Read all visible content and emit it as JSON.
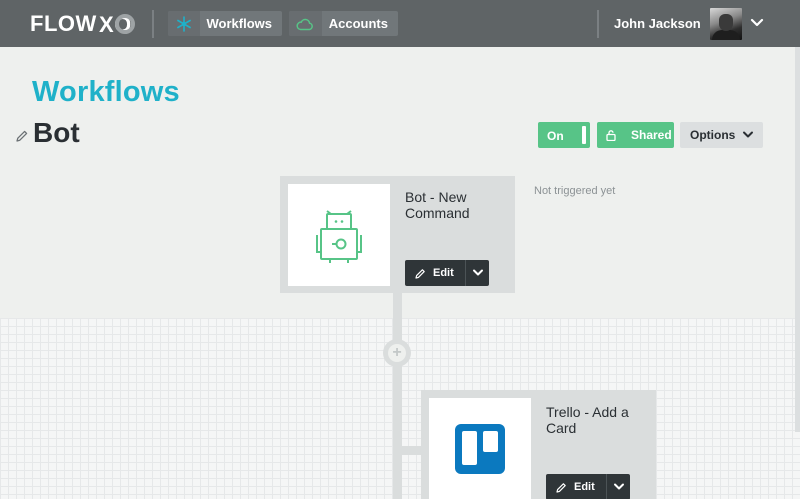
{
  "app": {
    "brand_left": "FLOW",
    "brand_right": "XO"
  },
  "nav": {
    "items": [
      {
        "label": "Workflows",
        "icon": "snowflake-icon"
      },
      {
        "label": "Accounts",
        "icon": "cloud-icon"
      }
    ]
  },
  "user": {
    "name": "John Jackson"
  },
  "page": {
    "title": "Workflows",
    "workflow_name": "Bot"
  },
  "controls": {
    "toggle_label": "On",
    "shared_label": "Shared",
    "options_label": "Options"
  },
  "steps": [
    {
      "title": "Bot - New Command",
      "edit_label": "Edit",
      "status": "Not triggered yet",
      "icon": "robot-icon"
    },
    {
      "title": "Trello - Add a Card",
      "edit_label": "Edit",
      "icon": "trello-icon"
    }
  ],
  "colors": {
    "accent": "#1fb1c9",
    "success": "#57c487",
    "topbar": "#5f6466",
    "trello": "#0b79bf",
    "robot": "#57c487"
  }
}
